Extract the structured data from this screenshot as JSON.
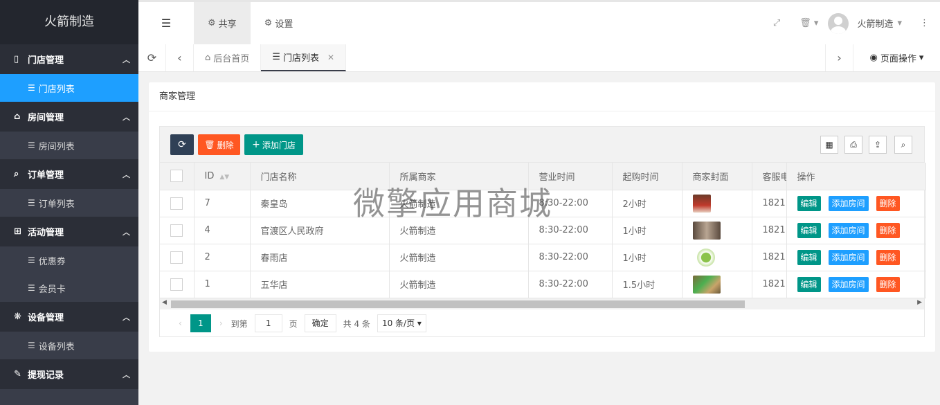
{
  "sidebar": {
    "logo": "火箭制造",
    "groups": [
      {
        "label": "门店管理",
        "items": [
          "门店列表"
        ]
      },
      {
        "label": "房间管理",
        "items": [
          "房间列表"
        ]
      },
      {
        "label": "订单管理",
        "items": [
          "订单列表"
        ]
      },
      {
        "label": "活动管理",
        "items": [
          "优惠券",
          "会员卡"
        ]
      },
      {
        "label": "设备管理",
        "items": [
          "设备列表"
        ]
      },
      {
        "label": "提现记录",
        "items": []
      }
    ]
  },
  "topbar": {
    "tabs": [
      "共享",
      "设置"
    ],
    "user": "火箭制造"
  },
  "tabbar": {
    "tabs": [
      "后台首页",
      "门店列表"
    ],
    "page_ops": "页面操作"
  },
  "card": {
    "title": "商家管理"
  },
  "toolbar": {
    "delete": "删除",
    "add": "添加门店"
  },
  "table": {
    "headers": [
      "ID",
      "门店名称",
      "所属商家",
      "营业时间",
      "起购时间",
      "商家封面",
      "客服电话",
      "操作"
    ],
    "rows": [
      {
        "id": "7",
        "name": "秦皇岛",
        "merchant": "火箭制造",
        "hours": "8:30-22:00",
        "min": "2小时",
        "phone": "1821"
      },
      {
        "id": "4",
        "name": "官渡区人民政府",
        "merchant": "火箭制造",
        "hours": "8:30-22:00",
        "min": "1小时",
        "phone": "1821"
      },
      {
        "id": "2",
        "name": "春雨店",
        "merchant": "火箭制造",
        "hours": "8:30-22:00",
        "min": "1小时",
        "phone": "1821"
      },
      {
        "id": "1",
        "name": "五华店",
        "merchant": "火箭制造",
        "hours": "8:30-22:00",
        "min": "1.5小时",
        "phone": "1821"
      }
    ],
    "actions": {
      "edit": "编辑",
      "add_room": "添加房间",
      "delete": "删除"
    }
  },
  "pager": {
    "current": "1",
    "goto_label": "到第",
    "page_input": "1",
    "page_unit": "页",
    "confirm": "确定",
    "total": "共 4 条",
    "page_size": "10 条/页"
  },
  "watermark": "微擎应用商城"
}
